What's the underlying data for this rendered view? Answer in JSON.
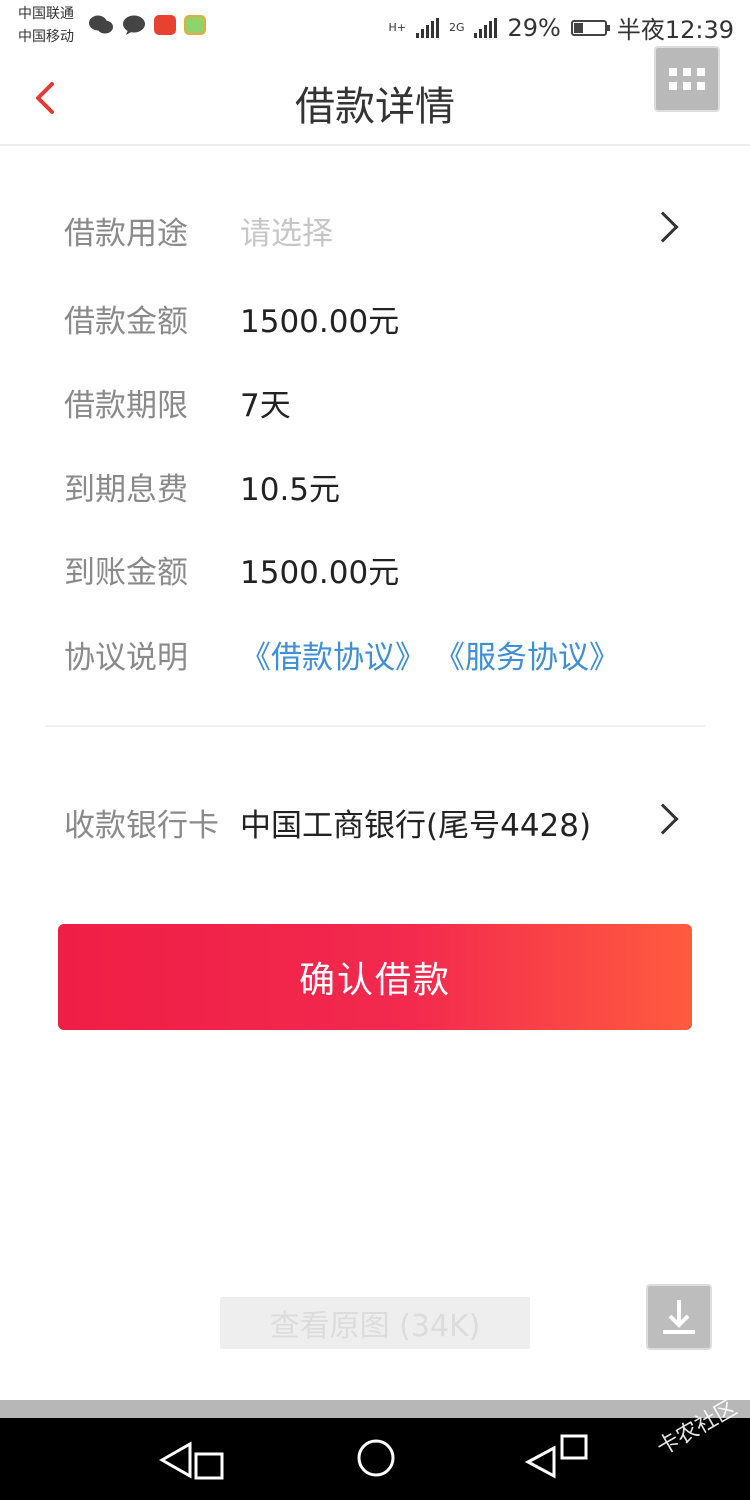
{
  "status_bar": {
    "carrier_1": "中国联通",
    "carrier_2": "中国移动",
    "network_1": "H+",
    "network_2": "2G",
    "battery_percent": "29%",
    "battery_level": 0.29,
    "time": "半夜12:39"
  },
  "header": {
    "title": "借款详情"
  },
  "loan_details": {
    "purpose_label": "借款用途",
    "purpose_placeholder": "请选择",
    "amount_label": "借款金额",
    "amount_value": "1500.00元",
    "term_label": "借款期限",
    "term_value": "7天",
    "fee_label": "到期息费",
    "fee_value": "10.5元",
    "received_label": "到账金额",
    "received_value": "1500.00元",
    "agreement_label": "协议说明",
    "loan_agreement_link": "《借款协议》",
    "service_agreement_link": "《服务协议》"
  },
  "bank_card": {
    "label": "收款银行卡",
    "value": "中国工商银行(尾号4428)"
  },
  "actions": {
    "confirm_label": "确认借款"
  },
  "viewer": {
    "view_original_label": "查看原图 (34K)"
  },
  "watermark": {
    "text": "卡农社区"
  },
  "colors": {
    "accent_red": "#f0204a",
    "link_blue": "#3e8fd6"
  }
}
